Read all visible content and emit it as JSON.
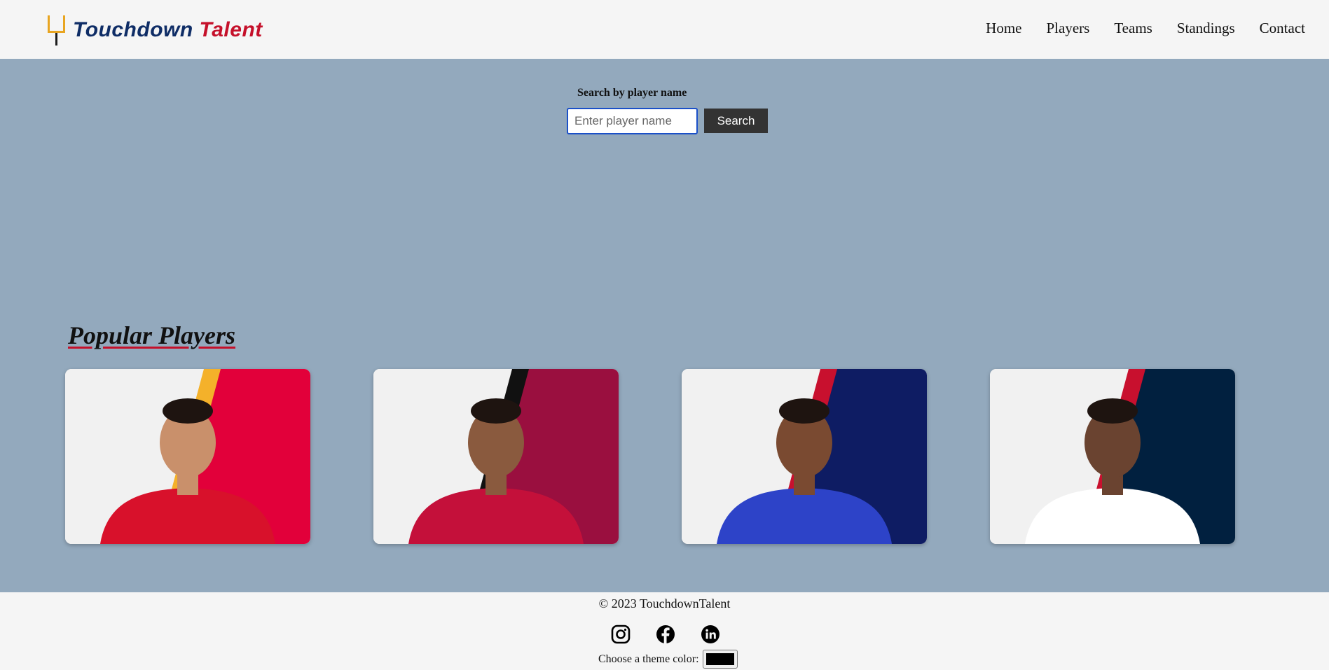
{
  "header": {
    "brand_part1": "Touchdown",
    "brand_part2": "Talent",
    "nav": [
      "Home",
      "Players",
      "Teams",
      "Standings",
      "Contact"
    ]
  },
  "search": {
    "label": "Search by player name",
    "placeholder": "Enter player name",
    "button_label": "Search"
  },
  "popular": {
    "title": "Popular Players",
    "cards": [
      {
        "jersey_color": "#d8112b",
        "bg_color": "#e2003a",
        "stripe_color": "#f4b12a",
        "skin": "#c9906b"
      },
      {
        "jersey_color": "#c4103a",
        "bg_color": "#9a0f3f",
        "stripe_color": "#111111",
        "skin": "#8a5a3e"
      },
      {
        "jersey_color": "#2d43c8",
        "bg_color": "#0e1c63",
        "stripe_color": "#c8102e",
        "skin": "#7a4a31"
      },
      {
        "jersey_color": "#ffffff",
        "bg_color": "#01203f",
        "stripe_color": "#c8102e",
        "skin": "#6a4330"
      }
    ]
  },
  "footer": {
    "copyright": "© 2023 TouchdownTalent",
    "social_icons": [
      "instagram-icon",
      "facebook-icon",
      "linkedin-icon"
    ],
    "theme_label": "Choose a theme color:",
    "theme_value": "#000000"
  }
}
